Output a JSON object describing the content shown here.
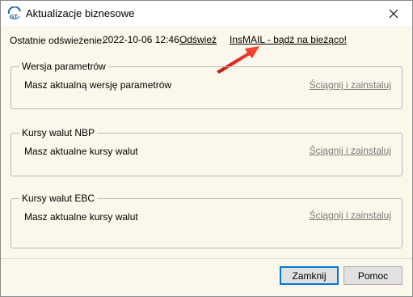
{
  "window": {
    "title": "Aktualizacje biznesowe"
  },
  "refresh": {
    "label": "Ostatnie odświeżenie:",
    "date": "2022-10-06 12:46",
    "refresh_link": "Odśwież",
    "insmail_link": "InsMAIL - bądź na bieżąco!"
  },
  "groups": [
    {
      "legend": "Wersja parametrów",
      "text": "Masz aktualną wersję parametrów",
      "link": "Ściągnij i zainstaluj"
    },
    {
      "legend": "Kursy walut NBP",
      "text": "Masz aktualne kursy walut",
      "link": "Ściągnij i zainstaluj"
    },
    {
      "legend": "Kursy walut EBC",
      "text": "Masz aktualne kursy walut",
      "link": "Ściągnij i zainstaluj"
    }
  ],
  "buttons": {
    "close": "Zamknij",
    "help": "Pomoc"
  },
  "colors": {
    "dialog_bg": "#fbf7ea",
    "arrow": "#e8261f",
    "disabled_link": "#7a7a7a",
    "default_button_border": "#0078d7"
  },
  "icons": {
    "app": "app-logo-icon",
    "close": "close-icon",
    "arrow": "red-arrow-icon"
  }
}
